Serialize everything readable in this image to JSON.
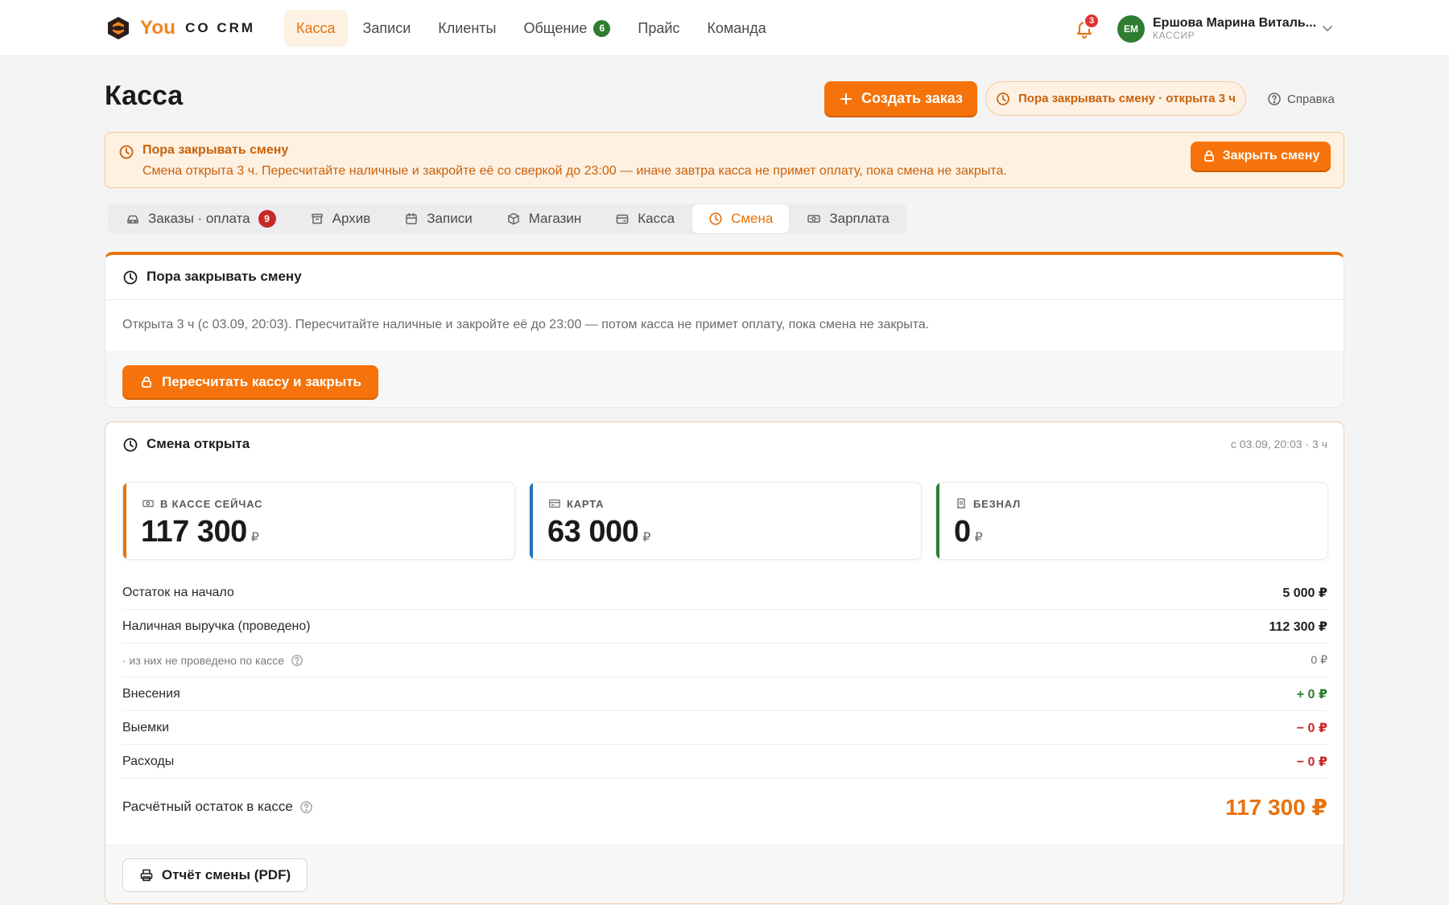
{
  "app": {
    "logo_you": "You",
    "logo_co": "CO CRM"
  },
  "nav": {
    "items": [
      {
        "label": "Касса",
        "active": true
      },
      {
        "label": "Записи"
      },
      {
        "label": "Клиенты"
      },
      {
        "label": "Общение",
        "badge": "6"
      },
      {
        "label": "Прайс"
      },
      {
        "label": "Команда"
      }
    ]
  },
  "notifications": {
    "count": "3"
  },
  "user": {
    "initials": "ЕМ",
    "name": "Ершова Марина Виталь...",
    "role": "КАССИР"
  },
  "header": {
    "title": "Касса",
    "create_order_label": "Создать заказ",
    "shift_pill_label": "Пора закрывать смену · открыта 3 ч",
    "help_label": "Справка"
  },
  "alert": {
    "title": "Пора закрывать смену",
    "text": "Смена открыта 3 ч. Пересчитайте наличные и закройте её со сверкой до 23:00 — иначе завтра касса не примет оплату, пока смена не закрыта.",
    "button_label": "Закрыть смену"
  },
  "tabs": [
    {
      "label": "Заказы · оплата",
      "badge": "9",
      "icon": "car-icon"
    },
    {
      "label": "Архив",
      "icon": "archive-icon"
    },
    {
      "label": "Записи",
      "icon": "calendar-icon"
    },
    {
      "label": "Магазин",
      "icon": "box-icon"
    },
    {
      "label": "Касса",
      "icon": "wallet-icon"
    },
    {
      "label": "Смена",
      "icon": "clock-icon",
      "active": true
    },
    {
      "label": "Зарплата",
      "icon": "banknote-icon"
    }
  ],
  "close_card": {
    "title": "Пора закрывать смену",
    "text": "Открыта 3 ч (с 03.09, 20:03). Пересчитайте наличные и закройте её до 23:00 — потом касса не примет оплату, пока смена не закрыта.",
    "button_label": "Пересчитать кассу и закрыть"
  },
  "shift_card": {
    "title": "Смена открыта",
    "meta": "с 03.09, 20:03 · 3 ч",
    "stats": [
      {
        "label": "В КАССЕ СЕЙЧАС",
        "value": "117 300",
        "currency": "₽",
        "accent": "#e8720c",
        "icon": "banknote-icon"
      },
      {
        "label": "КАРТА",
        "value": "63 000",
        "currency": "₽",
        "accent": "#1e73be",
        "icon": "card-icon"
      },
      {
        "label": "БЕЗНАЛ",
        "value": "0",
        "currency": "₽",
        "accent": "#2e7d32",
        "icon": "receipt-icon"
      }
    ],
    "rows": [
      {
        "label": "Остаток на начало",
        "value": "5 000 ₽"
      },
      {
        "label": "Наличная выручка (проведено)",
        "value": "112 300 ₽"
      },
      {
        "label": "· из них не проведено по кассе",
        "value": "0 ₽"
      },
      {
        "label": "Внесения",
        "value": "+ 0 ₽"
      },
      {
        "label": "Выемки",
        "value": "− 0 ₽"
      },
      {
        "label": "Расходы",
        "value": "− 0 ₽"
      }
    ],
    "total_label": "Расчётный остаток в кассе",
    "total_value": "117 300 ₽",
    "report_button_label": "Отчёт смены (PDF)"
  },
  "colors": {
    "accent": "#f5730a",
    "accent_text": "#e8720c",
    "success": "#2e7d32",
    "danger": "#c62828",
    "card_blue": "#1e73be"
  }
}
